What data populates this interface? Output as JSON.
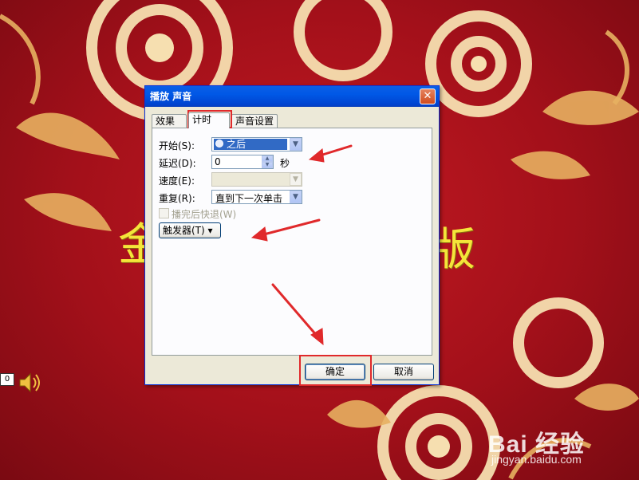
{
  "slide": {
    "title_left": "金",
    "title_right": "版",
    "counter": "0",
    "watermark": "Bai 经验",
    "watermark_url": "jingyan.baidu.com",
    "speaker_icon": "speaker-icon"
  },
  "dialog": {
    "title": "播放 声音",
    "close_icon": "close-icon",
    "tabs": [
      {
        "label": "效果",
        "active": false
      },
      {
        "label": "计时",
        "active": true
      },
      {
        "label": "声音设置",
        "active": false
      }
    ],
    "start": {
      "label": "开始(S):",
      "value": "之后"
    },
    "delay": {
      "label": "延迟(D):",
      "value": "0",
      "unit": "秒"
    },
    "speed": {
      "label": "速度(E):",
      "value": ""
    },
    "repeat": {
      "label": "重复(R):",
      "value": "直到下一次单击"
    },
    "rewind": {
      "label": "播完后快退(W)",
      "checked": false
    },
    "trigger_button": "触发器(T) ▾",
    "ok_button": "确定",
    "cancel_button": "取消"
  },
  "colors": {
    "background_red": "#b5121b",
    "title_yellow": "#f4e53a",
    "highlight_red": "#e0292b",
    "xp_blue": "#0058e6"
  }
}
